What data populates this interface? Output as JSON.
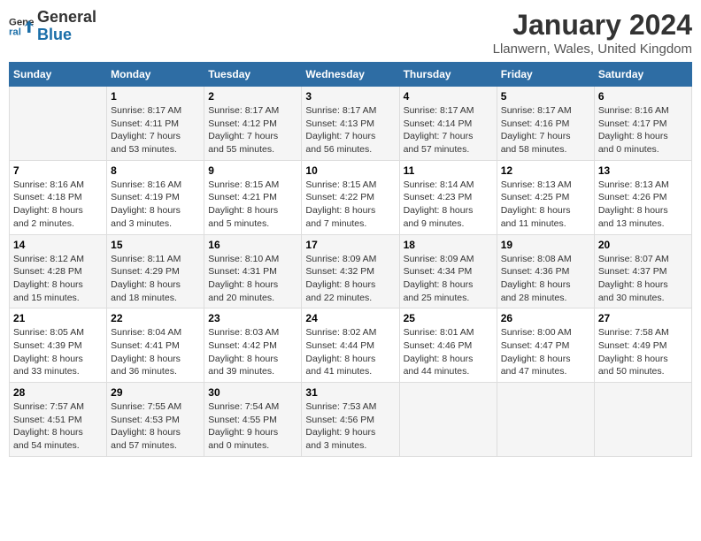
{
  "logo": {
    "line1": "General",
    "line2": "Blue"
  },
  "title": "January 2024",
  "subtitle": "Llanwern, Wales, United Kingdom",
  "days_of_week": [
    "Sunday",
    "Monday",
    "Tuesday",
    "Wednesday",
    "Thursday",
    "Friday",
    "Saturday"
  ],
  "weeks": [
    [
      {
        "num": "",
        "sunrise": "",
        "sunset": "",
        "daylight": ""
      },
      {
        "num": "1",
        "sunrise": "Sunrise: 8:17 AM",
        "sunset": "Sunset: 4:11 PM",
        "daylight": "Daylight: 7 hours and 53 minutes."
      },
      {
        "num": "2",
        "sunrise": "Sunrise: 8:17 AM",
        "sunset": "Sunset: 4:12 PM",
        "daylight": "Daylight: 7 hours and 55 minutes."
      },
      {
        "num": "3",
        "sunrise": "Sunrise: 8:17 AM",
        "sunset": "Sunset: 4:13 PM",
        "daylight": "Daylight: 7 hours and 56 minutes."
      },
      {
        "num": "4",
        "sunrise": "Sunrise: 8:17 AM",
        "sunset": "Sunset: 4:14 PM",
        "daylight": "Daylight: 7 hours and 57 minutes."
      },
      {
        "num": "5",
        "sunrise": "Sunrise: 8:17 AM",
        "sunset": "Sunset: 4:16 PM",
        "daylight": "Daylight: 7 hours and 58 minutes."
      },
      {
        "num": "6",
        "sunrise": "Sunrise: 8:16 AM",
        "sunset": "Sunset: 4:17 PM",
        "daylight": "Daylight: 8 hours and 0 minutes."
      }
    ],
    [
      {
        "num": "7",
        "sunrise": "Sunrise: 8:16 AM",
        "sunset": "Sunset: 4:18 PM",
        "daylight": "Daylight: 8 hours and 2 minutes."
      },
      {
        "num": "8",
        "sunrise": "Sunrise: 8:16 AM",
        "sunset": "Sunset: 4:19 PM",
        "daylight": "Daylight: 8 hours and 3 minutes."
      },
      {
        "num": "9",
        "sunrise": "Sunrise: 8:15 AM",
        "sunset": "Sunset: 4:21 PM",
        "daylight": "Daylight: 8 hours and 5 minutes."
      },
      {
        "num": "10",
        "sunrise": "Sunrise: 8:15 AM",
        "sunset": "Sunset: 4:22 PM",
        "daylight": "Daylight: 8 hours and 7 minutes."
      },
      {
        "num": "11",
        "sunrise": "Sunrise: 8:14 AM",
        "sunset": "Sunset: 4:23 PM",
        "daylight": "Daylight: 8 hours and 9 minutes."
      },
      {
        "num": "12",
        "sunrise": "Sunrise: 8:13 AM",
        "sunset": "Sunset: 4:25 PM",
        "daylight": "Daylight: 8 hours and 11 minutes."
      },
      {
        "num": "13",
        "sunrise": "Sunrise: 8:13 AM",
        "sunset": "Sunset: 4:26 PM",
        "daylight": "Daylight: 8 hours and 13 minutes."
      }
    ],
    [
      {
        "num": "14",
        "sunrise": "Sunrise: 8:12 AM",
        "sunset": "Sunset: 4:28 PM",
        "daylight": "Daylight: 8 hours and 15 minutes."
      },
      {
        "num": "15",
        "sunrise": "Sunrise: 8:11 AM",
        "sunset": "Sunset: 4:29 PM",
        "daylight": "Daylight: 8 hours and 18 minutes."
      },
      {
        "num": "16",
        "sunrise": "Sunrise: 8:10 AM",
        "sunset": "Sunset: 4:31 PM",
        "daylight": "Daylight: 8 hours and 20 minutes."
      },
      {
        "num": "17",
        "sunrise": "Sunrise: 8:09 AM",
        "sunset": "Sunset: 4:32 PM",
        "daylight": "Daylight: 8 hours and 22 minutes."
      },
      {
        "num": "18",
        "sunrise": "Sunrise: 8:09 AM",
        "sunset": "Sunset: 4:34 PM",
        "daylight": "Daylight: 8 hours and 25 minutes."
      },
      {
        "num": "19",
        "sunrise": "Sunrise: 8:08 AM",
        "sunset": "Sunset: 4:36 PM",
        "daylight": "Daylight: 8 hours and 28 minutes."
      },
      {
        "num": "20",
        "sunrise": "Sunrise: 8:07 AM",
        "sunset": "Sunset: 4:37 PM",
        "daylight": "Daylight: 8 hours and 30 minutes."
      }
    ],
    [
      {
        "num": "21",
        "sunrise": "Sunrise: 8:05 AM",
        "sunset": "Sunset: 4:39 PM",
        "daylight": "Daylight: 8 hours and 33 minutes."
      },
      {
        "num": "22",
        "sunrise": "Sunrise: 8:04 AM",
        "sunset": "Sunset: 4:41 PM",
        "daylight": "Daylight: 8 hours and 36 minutes."
      },
      {
        "num": "23",
        "sunrise": "Sunrise: 8:03 AM",
        "sunset": "Sunset: 4:42 PM",
        "daylight": "Daylight: 8 hours and 39 minutes."
      },
      {
        "num": "24",
        "sunrise": "Sunrise: 8:02 AM",
        "sunset": "Sunset: 4:44 PM",
        "daylight": "Daylight: 8 hours and 41 minutes."
      },
      {
        "num": "25",
        "sunrise": "Sunrise: 8:01 AM",
        "sunset": "Sunset: 4:46 PM",
        "daylight": "Daylight: 8 hours and 44 minutes."
      },
      {
        "num": "26",
        "sunrise": "Sunrise: 8:00 AM",
        "sunset": "Sunset: 4:47 PM",
        "daylight": "Daylight: 8 hours and 47 minutes."
      },
      {
        "num": "27",
        "sunrise": "Sunrise: 7:58 AM",
        "sunset": "Sunset: 4:49 PM",
        "daylight": "Daylight: 8 hours and 50 minutes."
      }
    ],
    [
      {
        "num": "28",
        "sunrise": "Sunrise: 7:57 AM",
        "sunset": "Sunset: 4:51 PM",
        "daylight": "Daylight: 8 hours and 54 minutes."
      },
      {
        "num": "29",
        "sunrise": "Sunrise: 7:55 AM",
        "sunset": "Sunset: 4:53 PM",
        "daylight": "Daylight: 8 hours and 57 minutes."
      },
      {
        "num": "30",
        "sunrise": "Sunrise: 7:54 AM",
        "sunset": "Sunset: 4:55 PM",
        "daylight": "Daylight: 9 hours and 0 minutes."
      },
      {
        "num": "31",
        "sunrise": "Sunrise: 7:53 AM",
        "sunset": "Sunset: 4:56 PM",
        "daylight": "Daylight: 9 hours and 3 minutes."
      },
      {
        "num": "",
        "sunrise": "",
        "sunset": "",
        "daylight": ""
      },
      {
        "num": "",
        "sunrise": "",
        "sunset": "",
        "daylight": ""
      },
      {
        "num": "",
        "sunrise": "",
        "sunset": "",
        "daylight": ""
      }
    ]
  ]
}
